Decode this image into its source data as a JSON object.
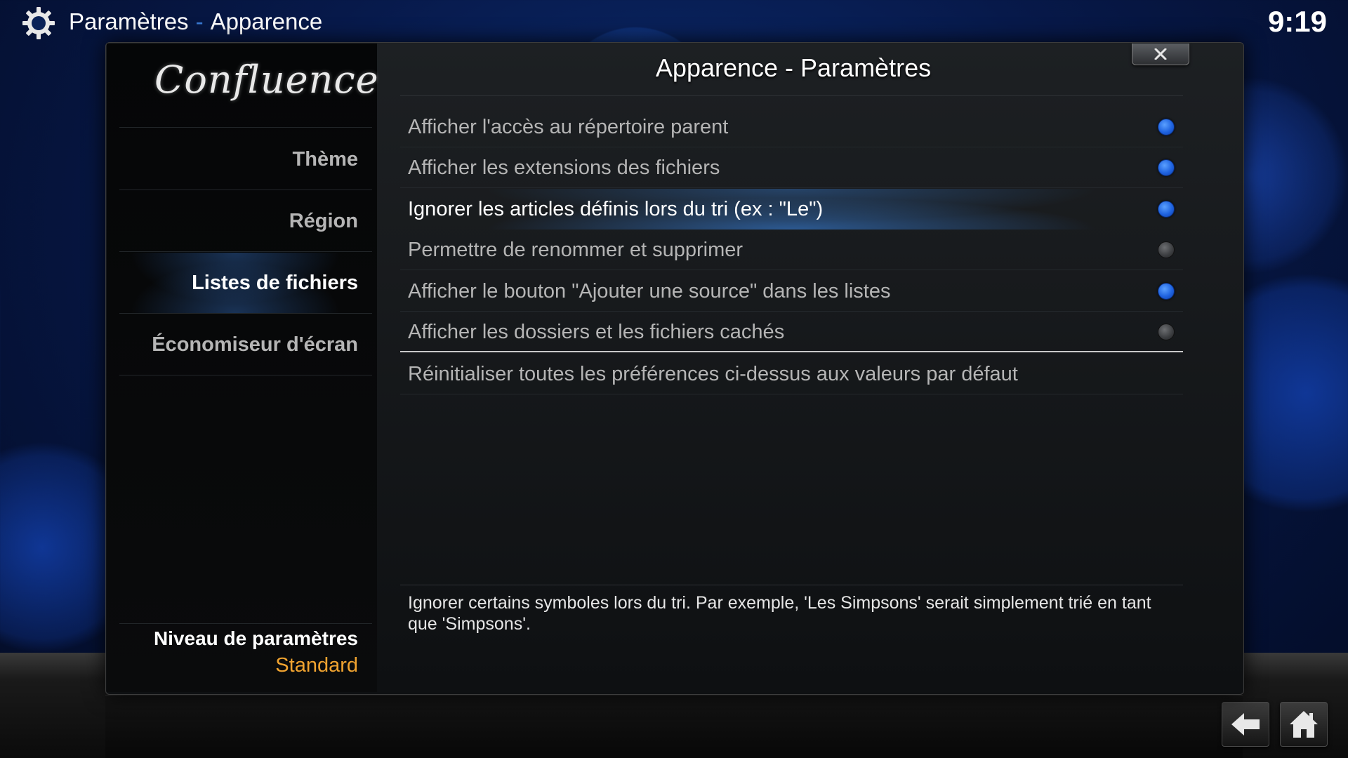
{
  "header": {
    "section": "Paramètres",
    "separator": "-",
    "page": "Apparence",
    "clock": "9:19"
  },
  "sidebar": {
    "logo": "Confluence",
    "items": [
      {
        "label": "Thème"
      },
      {
        "label": "Région"
      },
      {
        "label": "Listes de fichiers",
        "active": true
      },
      {
        "label": "Économiseur d'écran"
      }
    ],
    "settings_level_title": "Niveau de paramètres",
    "settings_level_value": "Standard"
  },
  "dialog": {
    "title": "Apparence - Paramètres",
    "settings": [
      {
        "label": "Afficher l'accès au répertoire parent",
        "enabled": true
      },
      {
        "label": "Afficher les extensions des fichiers",
        "enabled": true
      },
      {
        "label": "Ignorer les articles définis lors du tri (ex : \"Le\")",
        "enabled": true,
        "focused": true
      },
      {
        "label": "Permettre de renommer et supprimer",
        "enabled": false
      },
      {
        "label": "Afficher le bouton \"Ajouter une source\" dans les listes",
        "enabled": true
      },
      {
        "label": "Afficher les dossiers et les fichiers cachés",
        "enabled": false
      }
    ],
    "reset_label": "Réinitialiser toutes les préférences ci-dessus aux valeurs par défaut",
    "description": "Ignorer certains symboles lors du tri. Par exemple, 'Les Simpsons' serait simplement trié en tant que 'Simpsons'."
  },
  "icons": {
    "gear": "gear-icon",
    "close": "close-icon",
    "back": "back-arrow-icon",
    "home": "home-icon"
  },
  "colors": {
    "accent_blue": "#1f63e0",
    "level_value": "#f0a330"
  }
}
